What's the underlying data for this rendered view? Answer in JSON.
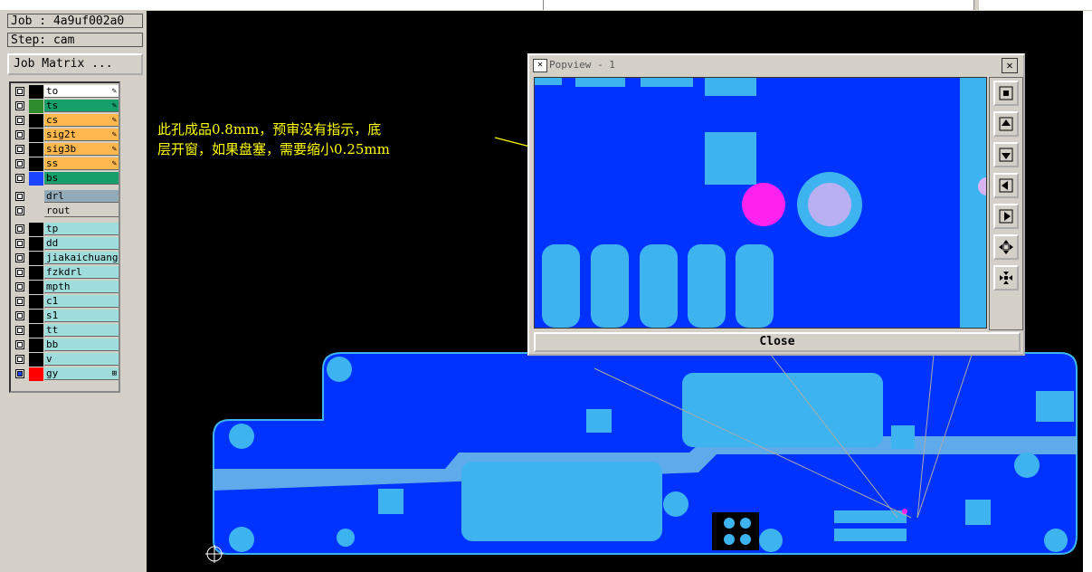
{
  "job_label": "Job : 4a9uf002a0",
  "step_label": "Step: cam",
  "job_matrix_label": "Job Matrix ...",
  "layers": [
    {
      "name": "to",
      "color": "#ffffff",
      "swatch": "#000000",
      "mark": "✎"
    },
    {
      "name": "ts",
      "color": "#169f6b",
      "swatch": "#2e8b2e",
      "mark": "✎"
    },
    {
      "name": "cs",
      "color": "#ffb84d",
      "swatch": "#000000",
      "mark": "✎"
    },
    {
      "name": "sig2t",
      "color": "#ffb84d",
      "swatch": "#000000",
      "mark": "✎"
    },
    {
      "name": "sig3b",
      "color": "#ffb84d",
      "swatch": "#000000",
      "mark": "✎"
    },
    {
      "name": "ss",
      "color": "#ffb84d",
      "swatch": "#000000",
      "mark": "✎"
    },
    {
      "name": "bs",
      "color": "#169f6b",
      "swatch": "#1a44ff",
      "mark": ""
    },
    {
      "name": "drl",
      "color": "#93aab8",
      "swatch": "#d4d0c8",
      "mark": ""
    },
    {
      "name": "rout",
      "color": "#d4d0c8",
      "swatch": "#d4d0c8",
      "mark": ""
    },
    {
      "name": "tp",
      "color": "#9fdcdc",
      "swatch": "#000000",
      "mark": ""
    },
    {
      "name": "dd",
      "color": "#9fdcdc",
      "swatch": "#000000",
      "mark": ""
    },
    {
      "name": "jiakaichuang",
      "color": "#9fdcdc",
      "swatch": "#000000",
      "mark": ""
    },
    {
      "name": "fzkdrl",
      "color": "#9fdcdc",
      "swatch": "#000000",
      "mark": ""
    },
    {
      "name": "mpth",
      "color": "#9fdcdc",
      "swatch": "#000000",
      "mark": ""
    },
    {
      "name": "c1",
      "color": "#9fdcdc",
      "swatch": "#000000",
      "mark": ""
    },
    {
      "name": "s1",
      "color": "#9fdcdc",
      "swatch": "#000000",
      "mark": ""
    },
    {
      "name": "tt",
      "color": "#9fdcdc",
      "swatch": "#000000",
      "mark": ""
    },
    {
      "name": "bb",
      "color": "#9fdcdc",
      "swatch": "#000000",
      "mark": ""
    },
    {
      "name": "v",
      "color": "#9fdcdc",
      "swatch": "#000000",
      "mark": ""
    },
    {
      "name": "gy",
      "color": "#9fdcdc",
      "swatch": "#ff0000",
      "mark": "⊞"
    }
  ],
  "annotation": {
    "line1": "此孔成品0.8mm，预审没有指示，底",
    "line2": "层开窗，如果盘塞，需要缩小0.25mm",
    "color": "#ffff00"
  },
  "popview": {
    "title": "Popview - 1",
    "close_x": "✕",
    "close_label": "Close"
  },
  "colors": {
    "board": "#0033ff",
    "pad": "#3db4f0",
    "highlight": "#ff22ee",
    "ring_inner": "#b8b0f0"
  }
}
